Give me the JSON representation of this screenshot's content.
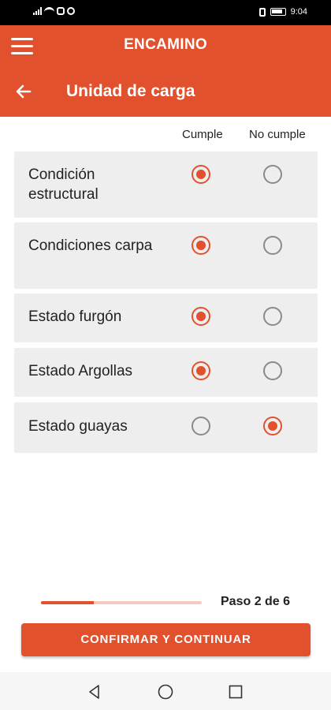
{
  "status_bar": {
    "time": "9:04"
  },
  "app_bar": {
    "title": "ENCAMINO"
  },
  "screen": {
    "title": "Unidad de carga"
  },
  "columns": {
    "yes": "Cumple",
    "no": "No cumple"
  },
  "items": [
    {
      "label": "Condición estructural",
      "selected": "yes"
    },
    {
      "label": "Condiciones carpa",
      "selected": "yes"
    },
    {
      "label": "Estado furgón",
      "selected": "yes"
    },
    {
      "label": "Estado Argollas",
      "selected": "yes"
    },
    {
      "label": "Estado guayas",
      "selected": "no"
    }
  ],
  "progress": {
    "label": "Paso 2 de 6",
    "current": 2,
    "total": 6,
    "fill_fraction": 0.33
  },
  "confirm_button": {
    "label": "CONFIRMAR Y CONTINUAR"
  },
  "colors": {
    "accent": "#e2512e",
    "row_background": "#eeeeee",
    "progress_track": "#f5cbbf"
  }
}
